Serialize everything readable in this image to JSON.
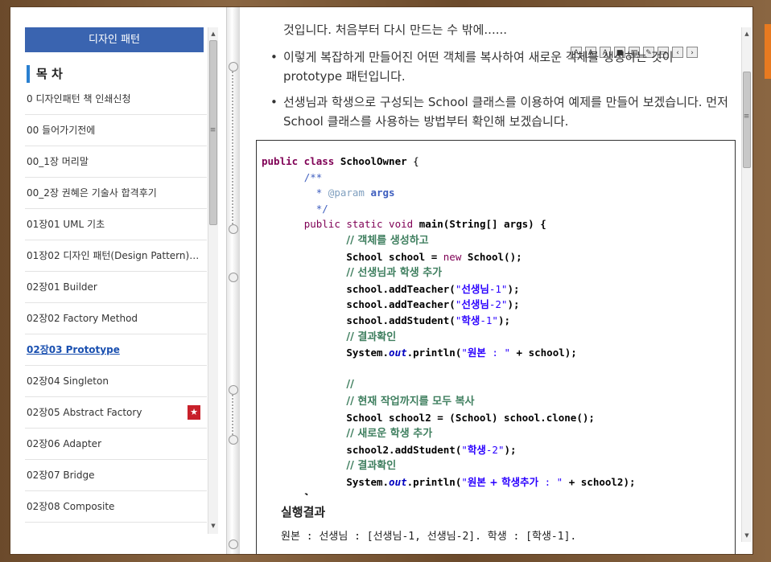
{
  "toc": {
    "title": "디자인 패턴",
    "heading": "목 차",
    "items": [
      {
        "label": "0 디자인패턴 책 인쇄신청"
      },
      {
        "label": "00 들어가기전에"
      },
      {
        "label": "00_1장 머리말"
      },
      {
        "label": "00_2장 권혜은 기술사 합격후기"
      },
      {
        "label": "01장01 UML 기초"
      },
      {
        "label": "01장02 디자인 패턴(Design Pattern)의..."
      },
      {
        "label": "02장01 Builder"
      },
      {
        "label": "02장02 Factory Method"
      },
      {
        "label": "02장03 Prototype"
      },
      {
        "label": "02장04 Singleton"
      },
      {
        "label": "02장05 Abstract Factory"
      },
      {
        "label": "02장06 Adapter"
      },
      {
        "label": "02장07 Bridge"
      },
      {
        "label": "02장08 Composite"
      }
    ],
    "active_index": 8,
    "bookmark_index": 10,
    "bookmark_icon": "bookmark-star-icon"
  },
  "content": {
    "top_partial": "것입니다. 처음부터 다시 만드는 수 밖에......",
    "bullets": [
      "이렇게 복잡하게 만들어진 어떤 객체를 복사하여 새로운 객체를 생성하는 것이 prototype 패턴입니다.",
      "선생님과 학생으로 구성되는 School 클래스를 이용하여 예제를 만들어 보겠습니다. 먼저 School 클래스를 사용하는 방법부터 확인해 보겠습니다."
    ],
    "toolbar_icons": [
      "text-size-up-icon",
      "text-size-down-icon",
      "text-size-icon",
      "bookmark-icon",
      "save-icon",
      "edit-icon",
      "print-icon",
      "prev-page-icon",
      "next-page-icon"
    ],
    "toolbar_glyphs": [
      "A",
      "A",
      "A",
      "■",
      "▤",
      "✎",
      "▭",
      "‹",
      "›"
    ],
    "result_heading": "실행결과",
    "result_text": "원본 : 선생님 : [선생님-1, 선생님-2]. 학생 : [학생-1]."
  },
  "code": {
    "l1_kw": "public class ",
    "l1_name": "SchoolOwner",
    "l1_end": " {",
    "l2": "/**",
    "l3_star": " * ",
    "l3_tag": "@param",
    "l3_arg": " args",
    "l4": " */",
    "l5_kw": "public static void ",
    "l5_name": "main",
    "l5_rest": "(String[] args) {",
    "l6": "// 객체를 생성하고",
    "l7_a": "School school = ",
    "l7_kw": "new",
    "l7_b": " School();",
    "l8": "// 선생님과 학생 추가",
    "l9_a": "school.addTeacher(",
    "l9_q1": "\"",
    "l9_k": "선생님",
    "l9_s": "-1\"",
    "l9_b": ");",
    "l10_a": "school.addTeacher(",
    "l10_q1": "\"",
    "l10_k": "선생님",
    "l10_s": "-2\"",
    "l10_b": ");",
    "l11_a": "school.addStudent(",
    "l11_q1": "\"",
    "l11_k": "학생",
    "l11_s": "-1\"",
    "l11_b": ");",
    "l12": "// 결과확인",
    "l13_a": "System.",
    "l13_out": "out",
    "l13_b": ".println(",
    "l13_q1": "\"",
    "l13_k": "원본",
    "l13_s": " : \"",
    "l13_c": " + school);",
    "l14": "//",
    "l15": "// 현재 작업까지를 모두 복사",
    "l16": "School school2 = (School) school.clone();",
    "l17": "// 새로운 학생 추가",
    "l18_a": "school2.addStudent(",
    "l18_q1": "\"",
    "l18_k": "학생",
    "l18_s": "-2\"",
    "l18_b": ");",
    "l19": "// 결과확인",
    "l20_a": "System.",
    "l20_out": "out",
    "l20_b": ".println(",
    "l20_q1": "\"",
    "l20_k": "원본 + 학생추가",
    "l20_s": " : \"",
    "l20_c": " + school2);",
    "l21": "}",
    "l22": "}"
  }
}
